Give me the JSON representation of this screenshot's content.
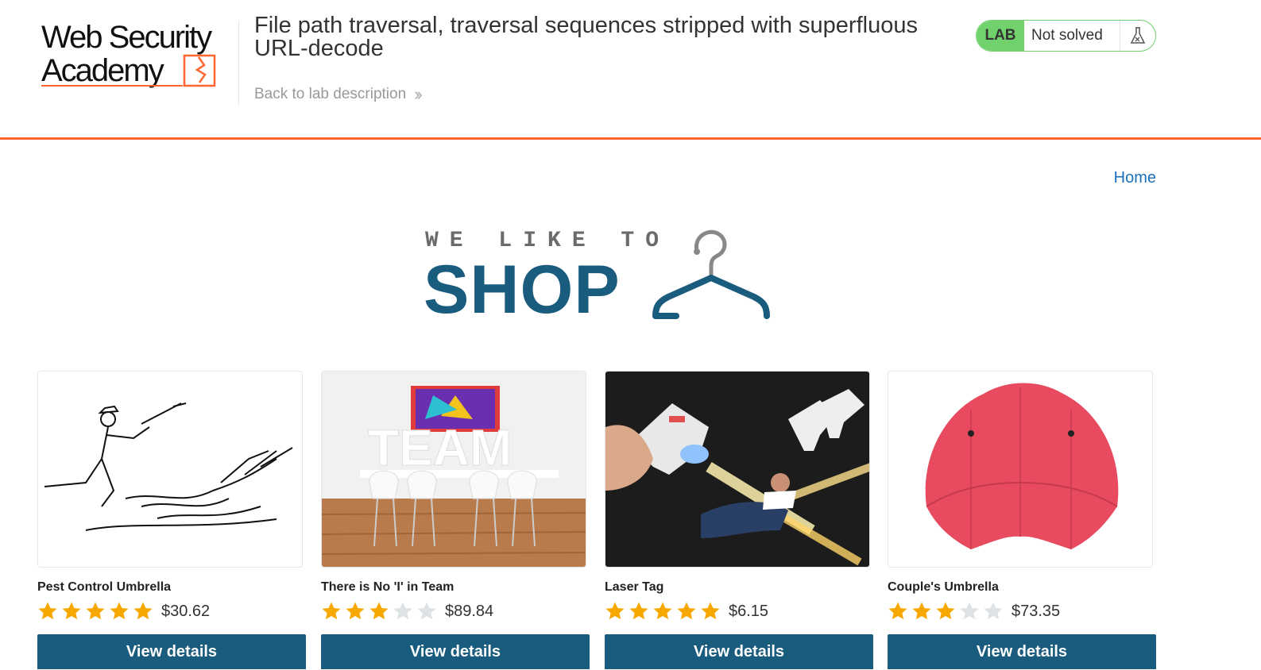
{
  "header": {
    "logo_line1": "Web Security",
    "logo_line2": "Academy",
    "lab_title": "File path traversal, traversal sequences stripped with superfluous URL-decode",
    "back_link": "Back to lab description",
    "lab_badge": "LAB",
    "lab_status": "Not solved",
    "colors": {
      "accent": "#ff6633",
      "solved_green": "#70d16d"
    }
  },
  "nav": {
    "home": "Home"
  },
  "banner": {
    "tagline": "WE LIKE TO",
    "headline": "SHOP",
    "colors": {
      "headline": "#1a5c7e",
      "tagline": "#6b6b6b"
    }
  },
  "products": [
    {
      "name": "Pest Control Umbrella",
      "price": "$30.62",
      "rating": 5,
      "max_rating": 5,
      "button": "View details"
    },
    {
      "name": "There is No 'I' in Team",
      "price": "$89.84",
      "rating": 3,
      "max_rating": 5,
      "button": "View details"
    },
    {
      "name": "Laser Tag",
      "price": "$6.15",
      "rating": 5,
      "max_rating": 5,
      "button": "View details"
    },
    {
      "name": "Couple's Umbrella",
      "price": "$73.35",
      "rating": 3,
      "max_rating": 5,
      "button": "View details"
    }
  ],
  "colors": {
    "star_filled": "#f7a800",
    "star_empty": "#dde2e4",
    "button": "#1a5c7e",
    "link": "#1a6fba"
  }
}
